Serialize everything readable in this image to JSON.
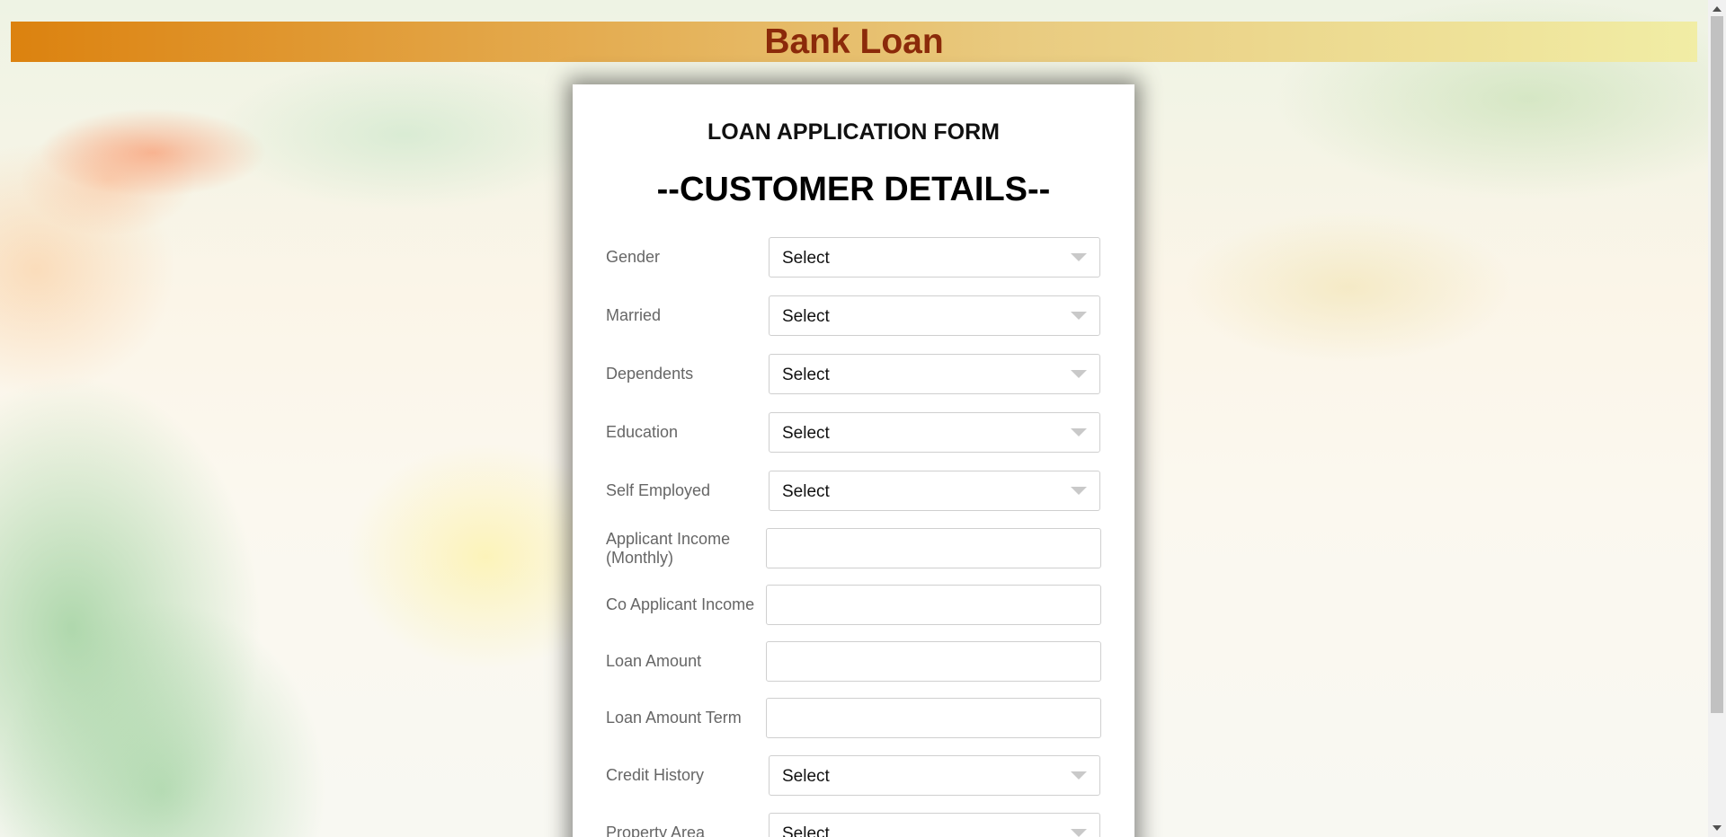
{
  "header": {
    "title": "Bank Loan"
  },
  "form": {
    "title": "LOAN APPLICATION FORM",
    "section_title": "--CUSTOMER DETAILS--",
    "fields": {
      "gender": {
        "label": "Gender",
        "value": "Select"
      },
      "married": {
        "label": "Married",
        "value": "Select"
      },
      "dependents": {
        "label": "Dependents",
        "value": "Select"
      },
      "education": {
        "label": "Education",
        "value": "Select"
      },
      "self_employed": {
        "label": "Self Employed",
        "value": "Select"
      },
      "applicant_income": {
        "label_line1": "Applicant Income",
        "label_line2": "(Monthly)",
        "value": ""
      },
      "coapplicant_income": {
        "label": "Co Applicant Income",
        "value": ""
      },
      "loan_amount": {
        "label": "Loan Amount",
        "value": ""
      },
      "loan_amount_term": {
        "label": "Loan Amount Term",
        "value": ""
      },
      "credit_history": {
        "label": "Credit History",
        "value": "Select"
      },
      "property_area": {
        "label": "Property Area",
        "value": "Select"
      }
    }
  },
  "colors": {
    "header_title": "#8b2a0a",
    "header_gradient_start": "#dc820f",
    "header_gradient_end": "#f1eda5",
    "label_text": "#666666"
  },
  "icons": {
    "select_arrow": "chevron-down-icon",
    "scroll_up": "scroll-up-arrow-icon",
    "scroll_down": "scroll-down-arrow-icon"
  }
}
